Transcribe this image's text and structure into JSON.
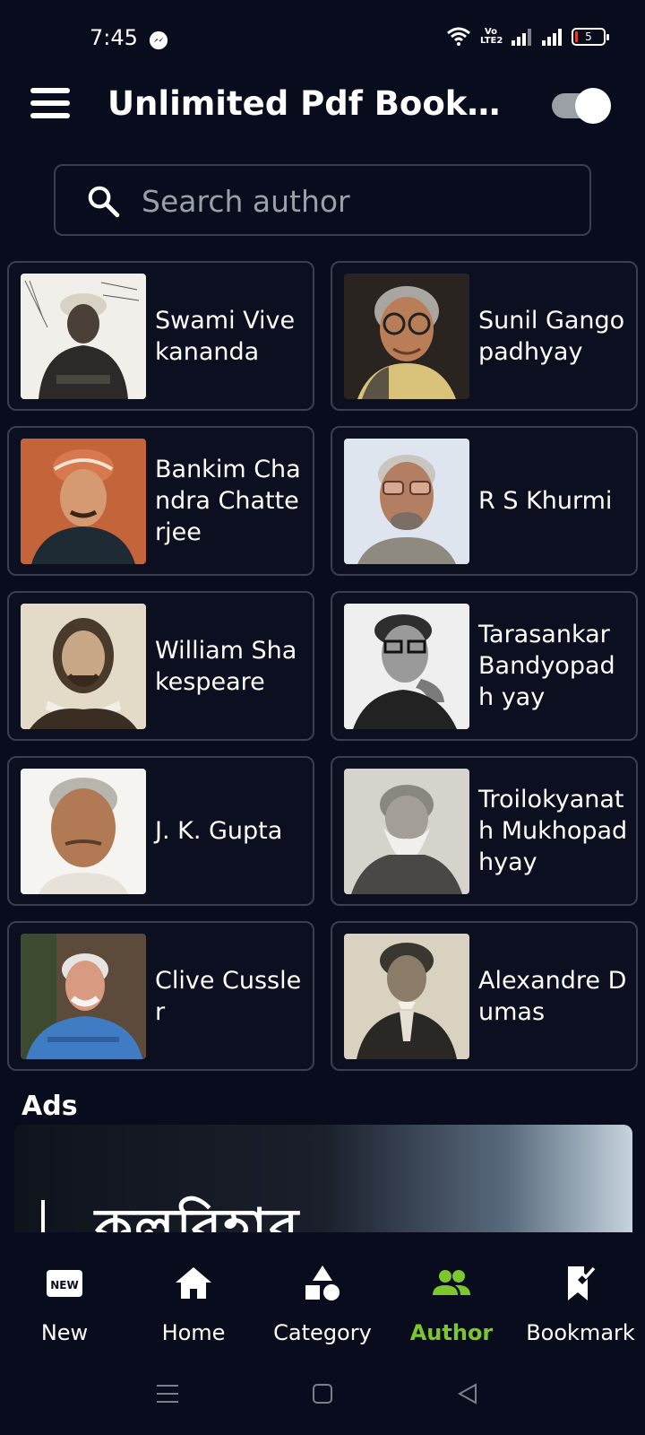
{
  "status_bar": {
    "time": "7:45",
    "volte": "Vo LTE2",
    "battery": "5"
  },
  "app_bar": {
    "title": "Unlimited Pdf Book Ho..."
  },
  "search": {
    "placeholder": "Search author"
  },
  "authors": [
    {
      "name": "Swami Vivekananda"
    },
    {
      "name": "Sunil Gango padhyay"
    },
    {
      "name": "Bankim Chandra Chatterjee"
    },
    {
      "name": "R S Khurmi"
    },
    {
      "name": "William Shakespeare"
    },
    {
      "name": "Tarasankar Bandyopadh yay"
    },
    {
      "name": "J. K. Gupta"
    },
    {
      "name": "Troilokyanat h Mukhopad hyay"
    },
    {
      "name": "Clive Cussler"
    },
    {
      "name": "Alexandre Dumas"
    }
  ],
  "ads": {
    "label": "Ads",
    "banner_text": "কলবিহার"
  },
  "bottom_nav": {
    "items": [
      {
        "label": "New",
        "icon": "new-badge-icon"
      },
      {
        "label": "Home",
        "icon": "home-icon"
      },
      {
        "label": "Category",
        "icon": "category-shapes-icon"
      },
      {
        "label": "Author",
        "icon": "people-icon"
      },
      {
        "label": "Bookmark",
        "icon": "bookmark-check-icon"
      }
    ],
    "active": "Author",
    "active_color": "#7cc72e"
  },
  "colors": {
    "background": "#080c1c",
    "card_border": "#3a3f4e",
    "accent": "#7cc72e"
  }
}
